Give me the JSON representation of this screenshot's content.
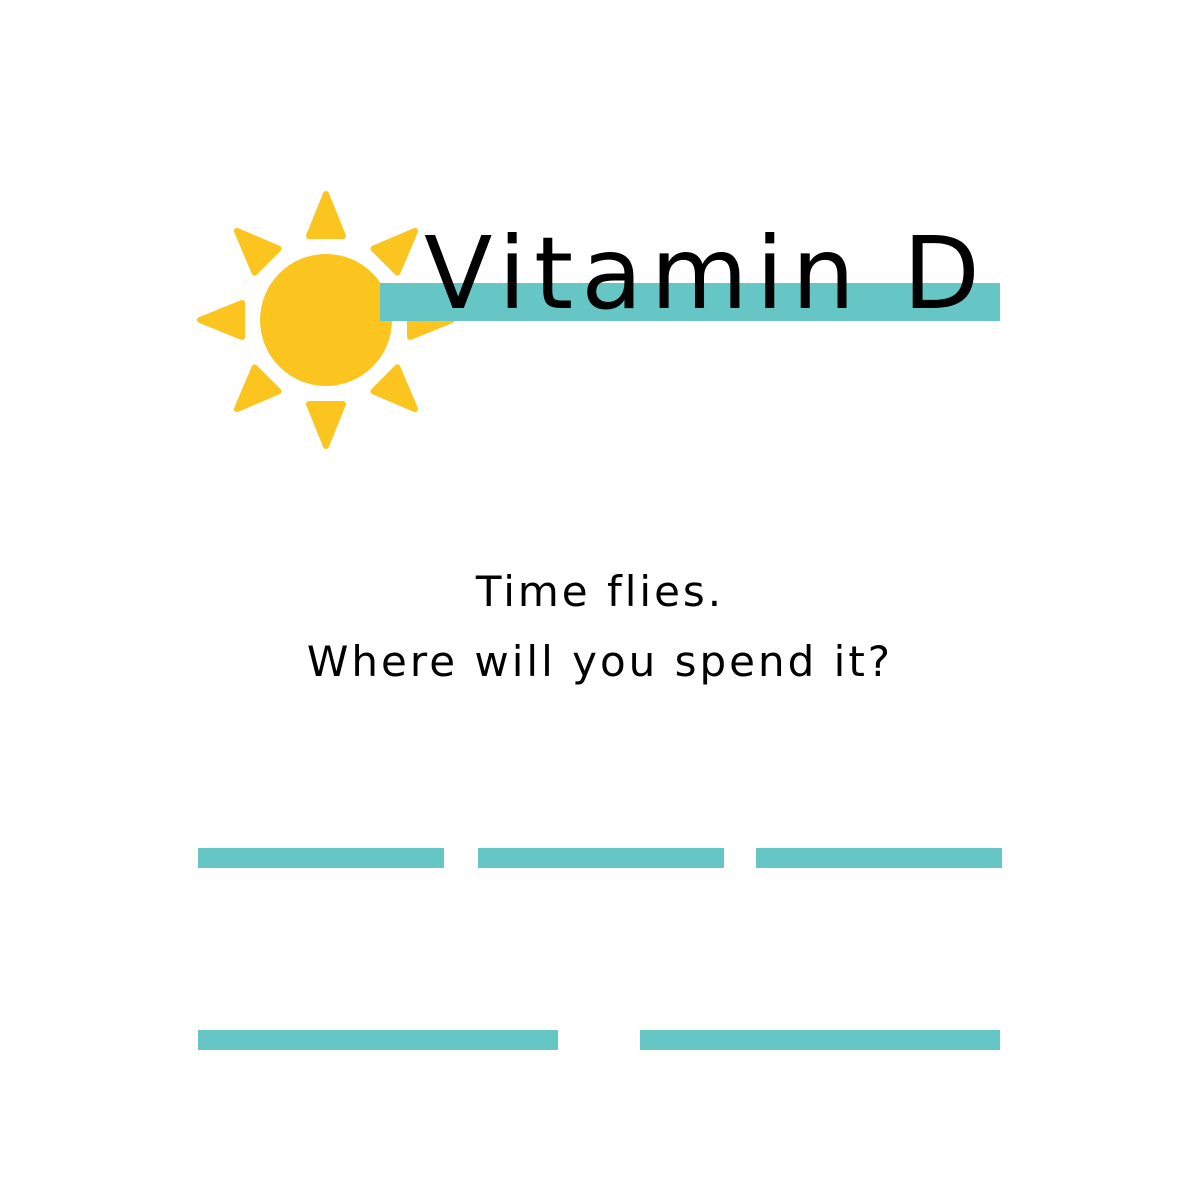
{
  "title": "Vitamin D",
  "tagline": {
    "line1": "Time flies.",
    "line2": "Where will you spend it?"
  },
  "icons": {
    "sun": "sun-icon"
  },
  "colors": {
    "accent": "#66c6c6",
    "sun": "#fbc41f",
    "text": "#000000",
    "background": "#ffffff"
  },
  "answer_blanks": {
    "row1_count": 3,
    "row2_count": 2
  }
}
